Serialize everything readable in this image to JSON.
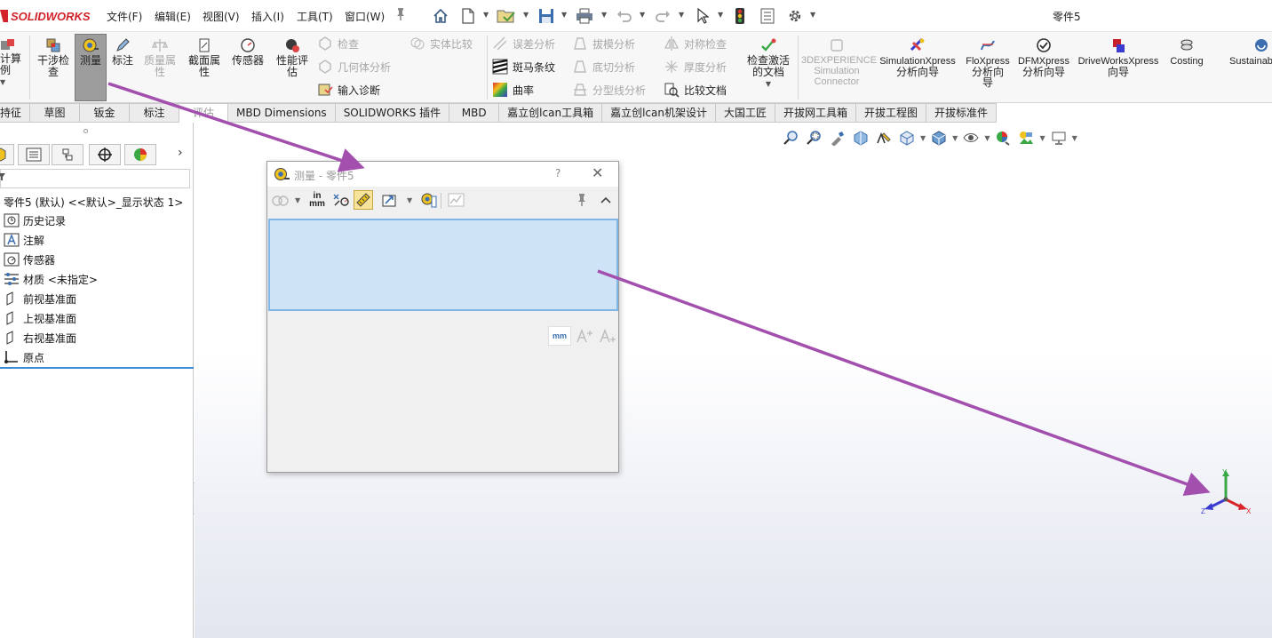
{
  "app": {
    "logo_text": "SOLIDWORKS",
    "document_title": "零件5"
  },
  "menu": {
    "items": [
      "文件(F)",
      "编辑(E)",
      "视图(V)",
      "插入(I)",
      "工具(T)",
      "窗口(W)"
    ]
  },
  "quick_access": {
    "icons": [
      "home-icon",
      "new-document-icon",
      "open-icon",
      "save-icon",
      "print-icon",
      "undo-icon",
      "redo-icon",
      "select-icon",
      "rebuild-icon",
      "file-properties-icon",
      "options-icon"
    ]
  },
  "ribbon": {
    "buttons": {
      "calc_example": "计算\n例",
      "interference": "干涉检\n查",
      "measure": "测量",
      "markup": "标注",
      "mass_props": "质量属\n性",
      "section_props": "截面属\n性",
      "sensor": "传感器",
      "perf_eval": "性能评\n估",
      "check_activate": "检查激活\n的文档",
      "experience": "3DEXPERIENCE\nSimulation\nConnector",
      "simxpress_1": "SimulationXpress",
      "simxpress_2": "分析向导",
      "floxpress_1": "FloXpress",
      "floxpress_2": "分析向",
      "floxpress_3": "导",
      "dfmxpress_1": "DFMXpress",
      "dfmxpress_2": "分析向导",
      "driveworks_1": "DriveWorksXpress",
      "driveworks_2": "向导",
      "costing": "Costing",
      "sustainability": "Sustainab"
    },
    "rows": {
      "check": "检查",
      "geometry_analysis": "几何体分析",
      "import_diagnosis": "输入诊断",
      "compare_solid": "实体比较",
      "deviation": "误差分析",
      "zebra": "斑马条纹",
      "curvature": "曲率",
      "draft": "拔模分析",
      "undercut": "底切分析",
      "parting_line": "分型线分析",
      "symmetry": "对称检查",
      "thickness": "厚度分析",
      "compare_docs": "比较文档"
    }
  },
  "tabs": [
    {
      "label": "持征",
      "active": false
    },
    {
      "label": "草图",
      "active": false
    },
    {
      "label": "钣金",
      "active": false
    },
    {
      "label": "标注",
      "active": false
    },
    {
      "label": "评估",
      "active": true
    },
    {
      "label": "MBD Dimensions",
      "active": false
    },
    {
      "label": "SOLIDWORKS 插件",
      "active": false
    },
    {
      "label": "MBD",
      "active": false
    },
    {
      "label": "嘉立创lcan工具箱",
      "active": false
    },
    {
      "label": "嘉立创lcan机架设计",
      "active": false
    },
    {
      "label": "大国工匠",
      "active": false
    },
    {
      "label": "开拔网工具箱",
      "active": false
    },
    {
      "label": "开拔工程图",
      "active": false
    },
    {
      "label": "开拔标准件",
      "active": false
    }
  ],
  "feature_tree": {
    "root": "零件5 (默认) <<默认>_显示状态 1>",
    "items": [
      {
        "label": "历史记录",
        "icon": "history-icon"
      },
      {
        "label": "注解",
        "icon": "annotation-icon"
      },
      {
        "label": "传感器",
        "icon": "sensor-icon"
      },
      {
        "label": "材质 <未指定>",
        "icon": "material-icon"
      },
      {
        "label": "前视基准面",
        "icon": "plane-icon"
      },
      {
        "label": "上视基准面",
        "icon": "plane-icon"
      },
      {
        "label": "右视基准面",
        "icon": "plane-icon"
      },
      {
        "label": "原点",
        "icon": "origin-icon"
      }
    ]
  },
  "measure_dialog": {
    "title": "测量 - 零件5",
    "help": "?",
    "close": "✕",
    "unit_in": "in",
    "unit_mm": "mm",
    "unit_tool_label": "mm"
  },
  "triad": {
    "x": "X",
    "y": "Y",
    "z": "Z"
  },
  "colors": {
    "accent": "#3a8ad6",
    "arrow": "#a24fae",
    "logo_red": "#d2232a",
    "selection_fill": "#cfe3f7"
  }
}
